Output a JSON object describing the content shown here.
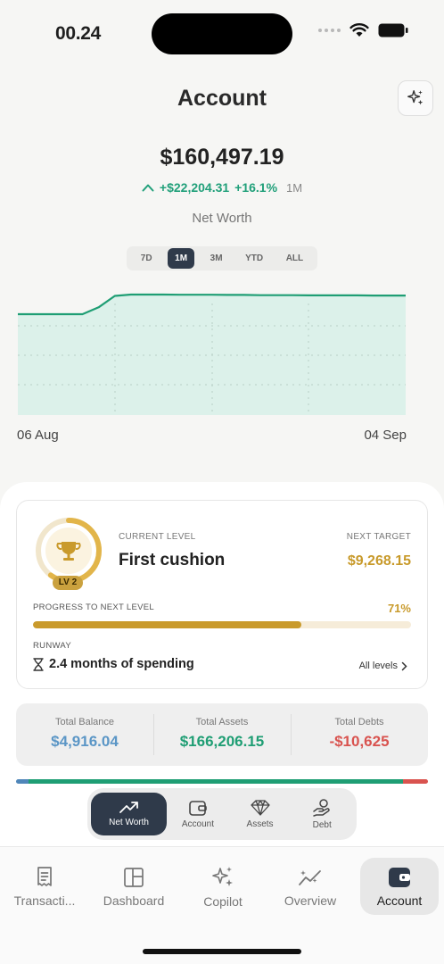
{
  "status": {
    "time": "00.24"
  },
  "header": {
    "title": "Account"
  },
  "summary": {
    "net_worth": "$160,497.19",
    "change_amount": "+$22,204.31",
    "change_pct": "+16.1%",
    "change_period": "1M",
    "label": "Net Worth"
  },
  "ranges": [
    "7D",
    "1M",
    "3M",
    "YTD",
    "ALL"
  ],
  "active_range": "1M",
  "chart_data": {
    "type": "area",
    "x_labels": [
      "06 Aug",
      "04 Sep"
    ],
    "relative_values": [
      0.0,
      0.0,
      0.0,
      0.0,
      0.0,
      0.35,
      0.93,
      1.0,
      1.0,
      1.0,
      0.99,
      0.99,
      0.99,
      0.98,
      0.98,
      0.97,
      0.97,
      0.97,
      0.96,
      0.96,
      0.96,
      0.96,
      0.95,
      0.95,
      0.95
    ],
    "grid": true,
    "line_color": "#1f9e74",
    "fill_color": "#dcf1ea"
  },
  "level": {
    "current_label": "CURRENT LEVEL",
    "current_name": "First cushion",
    "badge": "LV 2",
    "next_label": "NEXT TARGET",
    "next_value": "$9,268.15",
    "progress_label": "PROGRESS TO NEXT LEVEL",
    "progress_text": "71%",
    "progress": 0.71,
    "runway_label": "RUNWAY",
    "runway_value": "2.4 months of spending",
    "all_levels": "All levels"
  },
  "totals": [
    {
      "label": "Total Balance",
      "value": "$4,916.04",
      "color": "#5b96c6"
    },
    {
      "label": "Total Assets",
      "value": "$166,206.15",
      "color": "#1f9e74"
    },
    {
      "label": "Total Debts",
      "value": "-$10,625",
      "color": "#d9534f"
    }
  ],
  "allocation": [
    {
      "share": 0.03,
      "color": "#4f86b9"
    },
    {
      "share": 0.91,
      "color": "#1f9e74"
    },
    {
      "share": 0.06,
      "color": "#d9534f"
    }
  ],
  "subnav": [
    {
      "label": "Net Worth",
      "icon": "trend-up-icon",
      "active": true
    },
    {
      "label": "Account",
      "icon": "wallet-icon",
      "active": false
    },
    {
      "label": "Assets",
      "icon": "diamond-icon",
      "active": false
    },
    {
      "label": "Debt",
      "icon": "hand-coin-icon",
      "active": false
    }
  ],
  "tabs": [
    {
      "label": "Transacti...",
      "icon": "receipt-icon"
    },
    {
      "label": "Dashboard",
      "icon": "dashboard-icon"
    },
    {
      "label": "Copilot",
      "icon": "sparkle-icon"
    },
    {
      "label": "Overview",
      "icon": "sparkline-icon"
    },
    {
      "label": "Account",
      "icon": "wallet-icon",
      "active": true
    }
  ],
  "colors": {
    "accent_dark": "#2f3a4a",
    "gold": "#c89a2b",
    "green": "#1f9e74"
  }
}
